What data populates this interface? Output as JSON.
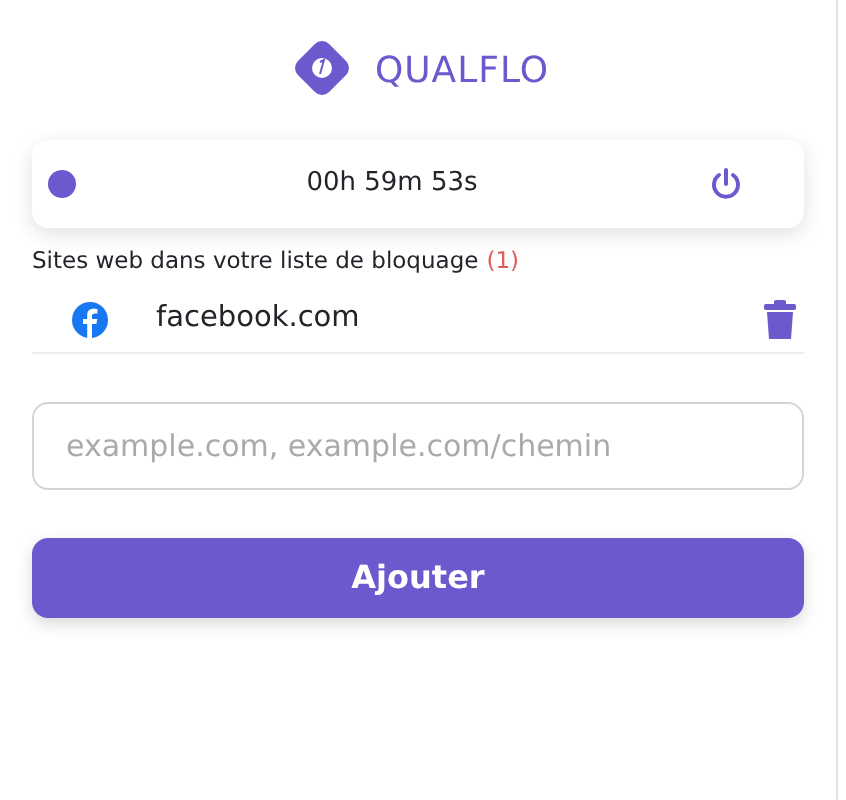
{
  "brand": {
    "name": "QUALFLO"
  },
  "timer": {
    "active": true,
    "time": "00h 59m 53s"
  },
  "blocklist": {
    "title": "Sites web dans votre liste de bloquage",
    "count": "(1)",
    "sites": [
      {
        "domain": "facebook.com"
      }
    ]
  },
  "input": {
    "placeholder": "example.com, example.com/chemin"
  },
  "add_button": "Ajouter"
}
